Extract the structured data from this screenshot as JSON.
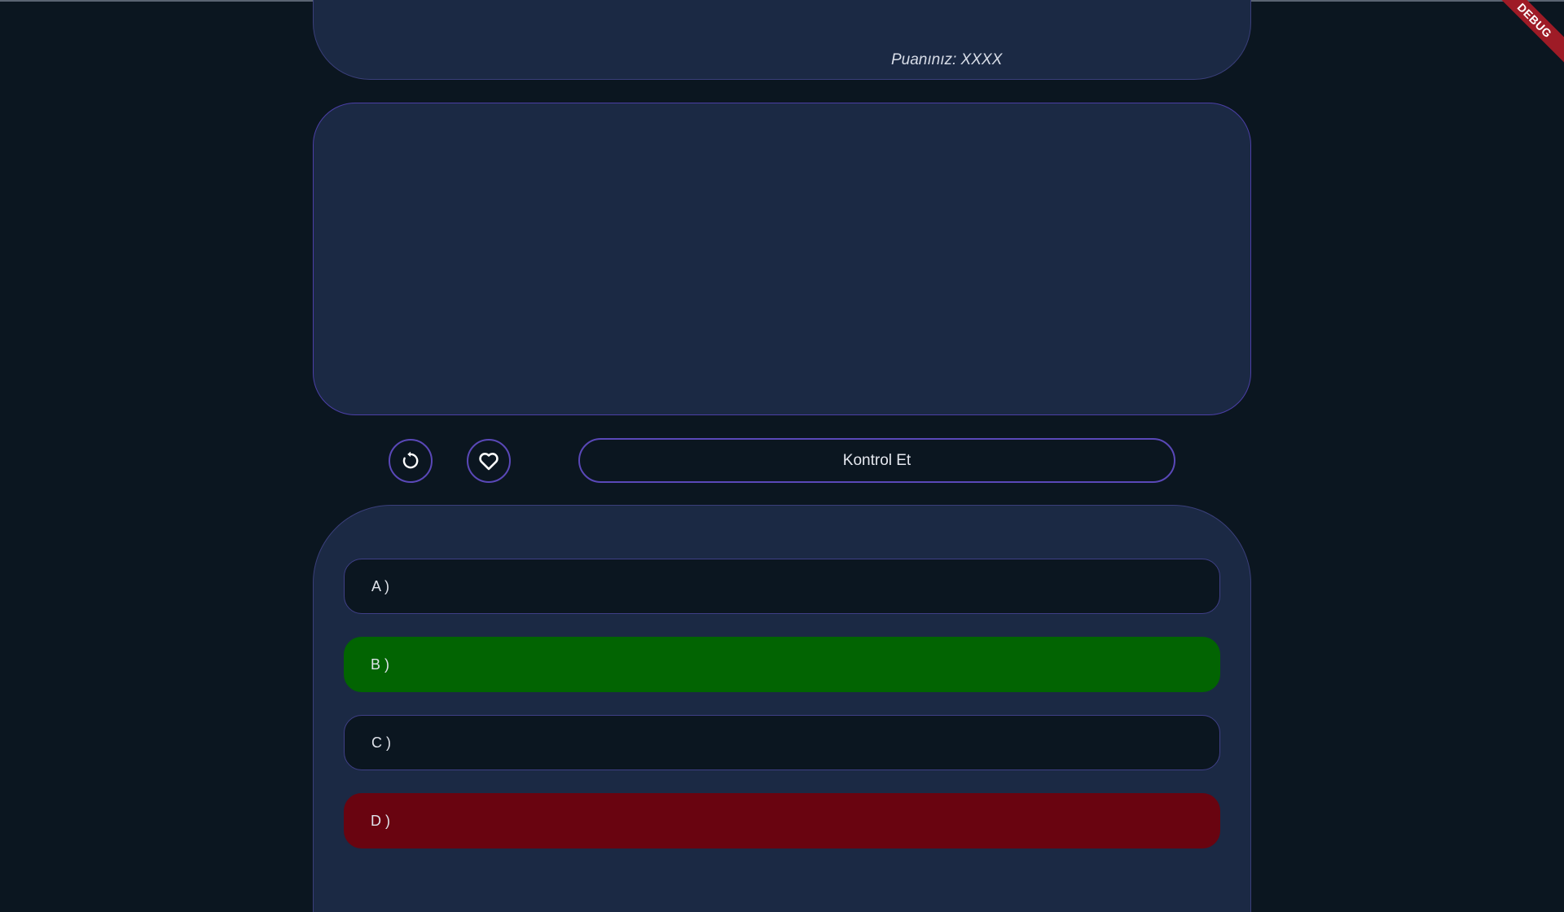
{
  "header": {
    "score_label": "Puanınız: XXXX"
  },
  "question": {
    "text": ""
  },
  "controls": {
    "refresh_icon": "refresh-icon",
    "favorite_icon": "heart-icon",
    "check_label": "Kontrol Et"
  },
  "options": [
    {
      "label": "A )",
      "state": "neutral"
    },
    {
      "label": "B )",
      "state": "correct"
    },
    {
      "label": "C )",
      "state": "neutral"
    },
    {
      "label": "D )",
      "state": "wrong"
    }
  ],
  "debug_banner": {
    "label": "DEBUG"
  },
  "colors": {
    "background": "#0b1620",
    "panel": "#1b2944",
    "accent_border": "#5a48b8",
    "correct": "#026402",
    "wrong": "#690410",
    "debug": "#9e1b26"
  }
}
